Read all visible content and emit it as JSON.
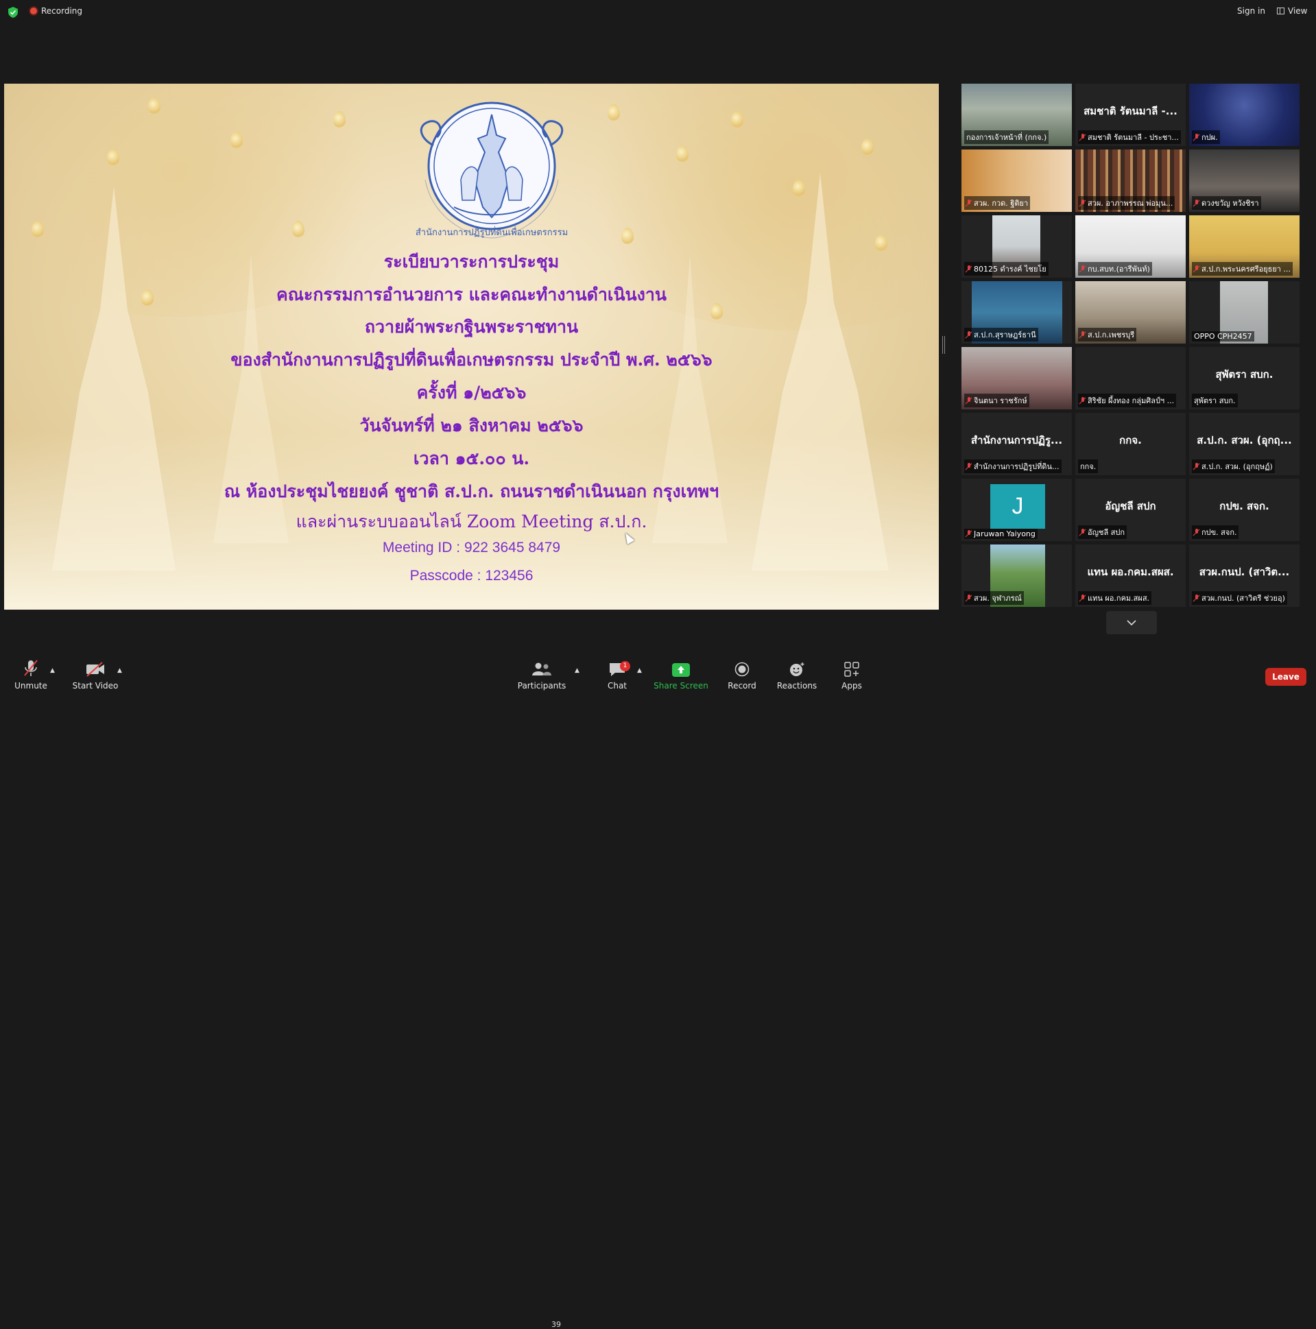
{
  "top_bar": {
    "recording_label": "Recording",
    "sign_in_label": "Sign in",
    "view_label": "View"
  },
  "slide": {
    "line1": "ระเบียบวาระการประชุม",
    "line2": "คณะกรรมการอำนวยการ และคณะทำงานดำเนินงาน",
    "line3": "ถวายผ้าพระกฐินพระราชทาน",
    "line4": "ของสำนักงานการปฏิรูปที่ดินเพื่อเกษตรกรรม ประจำปี พ.ศ. ๒๕๖๖",
    "line5": "ครั้งที่ ๑/๒๕๖๖",
    "line6": "วันจันทร์ที่ ๒๑ สิงหาคม ๒๕๖๖",
    "line7": "เวลา ๑๕.๐๐ น.",
    "line8": "ณ ห้องประชุมไชยยงค์ ชูชาติ ส.ป.ก. ถนนราชดำเนินนอก กรุงเทพฯ",
    "line9": "และผ่านระบบออนไลน์ Zoom Meeting ส.ป.ก.",
    "meeting_id": "Meeting ID : 922 3645 8479",
    "passcode": "Passcode : 123456",
    "seal_text": "สำนักงานการปฏิรูปที่ดินเพื่อเกษตรกรรม"
  },
  "gallery": {
    "tiles": [
      {
        "label": "กองการเจ้าหน้าที่ (กกจ.)",
        "big": "",
        "video": "room",
        "muted": false,
        "active": true
      },
      {
        "label": "สมชาติ รัตนมาลี - ประชา...",
        "big": "สมชาติ รัตนมาลี -...",
        "video": "",
        "muted": true
      },
      {
        "label": "กปผ.",
        "big": "",
        "video": "blue",
        "muted": true
      },
      {
        "label": "สวผ. กวด. ฐิติยา",
        "big": "",
        "video": "warm",
        "muted": true
      },
      {
        "label": "สวผ. อาภาพรรณ พ่อมุน...",
        "big": "",
        "video": "books",
        "muted": true
      },
      {
        "label": "ดวงขวัญ หวังชิรา",
        "big": "",
        "video": "dark",
        "muted": true
      },
      {
        "label": "80125 ดำรงค์ ไชยโย",
        "big": "",
        "video": "ceiling",
        "muted": true
      },
      {
        "label": "กบ.สบท.(อารีพันท์)",
        "big": "",
        "video": "white",
        "muted": true
      },
      {
        "label": "ส.ป.ก.พระนครศรีอยุธยา ...",
        "big": "",
        "video": "yellow",
        "muted": true
      },
      {
        "label": "ส.ป.ก.สุราษฎร์ธานี",
        "big": "",
        "video": "sea",
        "muted": true
      },
      {
        "label": "ส.ป.ก.เพชรบุรี",
        "big": "",
        "video": "office",
        "muted": true
      },
      {
        "label": "OPPO CPH2457",
        "big": "",
        "video": "gray",
        "muted": false
      },
      {
        "label": "จินตนา ราชรักษ์",
        "big": "",
        "video": "woman",
        "muted": true
      },
      {
        "label": "สิริชัย ผึ้งทอง กลุ่มศิลป์ฯ ...",
        "big": "",
        "video": "",
        "muted": true
      },
      {
        "label": "สุพัตรา สบก.",
        "big": "สุพัตรา สบก.",
        "video": "",
        "muted": false
      },
      {
        "label": "สำนักงานการปฏิรูปที่ดิน...",
        "big": "สำนักงานการปฏิรู...",
        "video": "",
        "muted": true
      },
      {
        "label": "กกจ.",
        "big": "กกจ.",
        "video": "",
        "muted": false
      },
      {
        "label": "ส.ป.ก. สวผ. (อุกฤษฏ์)",
        "big": "ส.ป.ก. สวผ. (อุกฤ...",
        "video": "",
        "muted": true
      },
      {
        "label": "Jaruwan Yaiyong",
        "big": "",
        "video": "avatar",
        "avatar_letter": "J",
        "muted": true
      },
      {
        "label": "อัญชลี สปก",
        "big": "อัญชลี สปก",
        "video": "",
        "muted": true
      },
      {
        "label": "กปข. สจก.",
        "big": "กปข. สจก.",
        "video": "",
        "muted": true
      },
      {
        "label": "สวผ. จุฬาภรณ์",
        "big": "",
        "video": "hills",
        "muted": true
      },
      {
        "label": "แทน ผอ.กคม.สผส.",
        "big": "แทน ผอ.กคม.สผส.",
        "video": "",
        "muted": true
      },
      {
        "label": "สวผ.กนป. (สาวิตรี ช่วยอุ)",
        "big": "สวผ.กนป. (สาวิต...",
        "video": "",
        "muted": true
      }
    ]
  },
  "toolbar": {
    "unmute_label": "Unmute",
    "start_video_label": "Start Video",
    "participants_label": "Participants",
    "participants_count": "39",
    "chat_label": "Chat",
    "chat_badge": "1",
    "share_screen_label": "Share Screen",
    "record_label": "Record",
    "reactions_label": "Reactions",
    "apps_label": "Apps",
    "leave_label": "Leave"
  },
  "colors": {
    "share_green": "#2fbf4f",
    "leave_red": "#c8281f",
    "slide_text_purple": "#7a1fbf",
    "active_tile_border": "#d8e24a"
  }
}
